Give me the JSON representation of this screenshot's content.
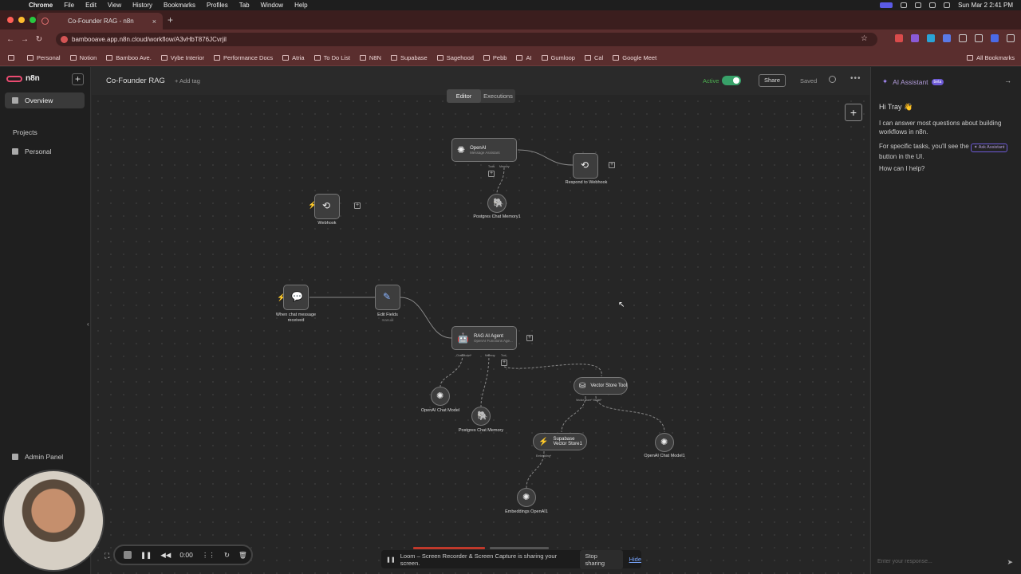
{
  "macos_menu": {
    "app": "Chrome",
    "items": [
      "File",
      "Edit",
      "View",
      "History",
      "Bookmarks",
      "Profiles",
      "Tab",
      "Window",
      "Help"
    ],
    "clock": "Sun Mar 2  2:41 PM"
  },
  "browser": {
    "tab_title": "Co-Founder RAG - n8n",
    "url": "bambooave.app.n8n.cloud/workflow/A3vHbT876JCvrjil",
    "bookmarks": [
      "Personal",
      "Notion",
      "Bamboo Ave.",
      "Vybe Interior",
      "Performance Docs",
      "Atria",
      "To Do List",
      "N8N",
      "Supabase",
      "Sagehood",
      "Pebb",
      "AI",
      "Gumloop",
      "Cal",
      "Google Meet"
    ],
    "all_bookmarks": "All Bookmarks"
  },
  "sidebar": {
    "brand": "n8n",
    "overview": "Overview",
    "projects_heading": "Projects",
    "personal": "Personal",
    "admin_panel": "Admin Panel"
  },
  "header": {
    "workflow_name": "Co-Founder RAG",
    "add_tag": "+ Add tag",
    "active_label": "Active",
    "share": "Share",
    "saved": "Saved",
    "more": "•••",
    "tabs": [
      "Editor",
      "Executions"
    ]
  },
  "nodes": {
    "openai": {
      "title": "OpenAI",
      "sub": "Message Assistant",
      "port_tools": "Tools",
      "port_memory": "Memory"
    },
    "respond": {
      "label": "Respond to Webhook"
    },
    "webhook": {
      "label": "Webhook"
    },
    "postgres1": {
      "label": "Postgres Chat Memory1"
    },
    "chat_trigger": {
      "label": "When chat message received"
    },
    "edit_fields": {
      "label": "Edit Fields",
      "sub": "manual"
    },
    "rag_agent": {
      "title": "RAG AI Agent",
      "sub": "OpenAI Functions Age...",
      "port_model": "Chat Model*",
      "port_memory": "Memory",
      "port_tool": "Tool"
    },
    "openai_chat": {
      "label": "OpenAI Chat Model"
    },
    "postgres": {
      "label": "Postgres Chat Memory"
    },
    "vector_tool": {
      "title": "Vector Store Tool",
      "port": "Vector Store*  Model*"
    },
    "supabase": {
      "title": "Supabase Vector Store1",
      "port": "Embedding*"
    },
    "openai_chat1": {
      "label": "OpenAI Chat Model1"
    },
    "embeddings": {
      "label": "Embeddings OpenAI1"
    }
  },
  "assistant": {
    "title": "AI Assistant",
    "badge": "beta",
    "greeting": "Hi Tray 👋",
    "line1": "I can answer most questions about building workflows in n8n.",
    "line2_pre": "For specific tasks, you'll see the",
    "ask_pill": "✦ Ask Assistant",
    "line2_post": "button in the UI.",
    "line3": "How can I help?",
    "input_placeholder": "Enter your response..."
  },
  "recorder": {
    "time": "0:00",
    "banner": "Loom – Screen Recorder & Screen Capture is sharing your screen.",
    "stop_sharing": "Stop sharing",
    "hide": "Hide"
  },
  "colors": {
    "n8n_brand": "#ea4b71",
    "active_green": "#38a169",
    "assistant_purple": "#a78bfa",
    "trigger_orange": "#ff6a3d"
  }
}
